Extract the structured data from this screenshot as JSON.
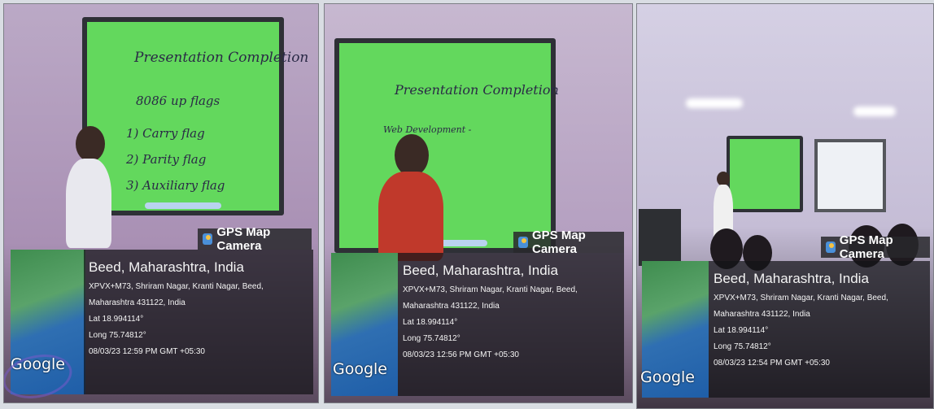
{
  "panels": [
    {
      "board_lines": [
        "Presentation Completion",
        "8086 up flags",
        "1) Carry flag",
        "2) Parity flag",
        "3) Auxiliary flag"
      ],
      "gps_tag": "GPS Map Camera",
      "title": "Beed, Maharashtra, India",
      "address1": "XPVX+M73, Shriram Nagar, Kranti Nagar, Beed,",
      "address2": "Maharashtra 431122, India",
      "lat": "Lat 18.994114°",
      "long": "Long 75.74812°",
      "datetime": "08/03/23 12:59 PM GMT +05:30",
      "map_label": "Google"
    },
    {
      "board_lines": [
        "Presentation Completion",
        "Web Development -"
      ],
      "gps_tag": "GPS Map Camera",
      "title": "Beed, Maharashtra, India",
      "address1": "XPVX+M73, Shriram Nagar, Kranti Nagar, Beed,",
      "address2": "Maharashtra 431122, India",
      "lat": "Lat 18.994114°",
      "long": "Long 75.74812°",
      "datetime": "08/03/23 12:56 PM GMT +05:30",
      "map_label": "Google"
    },
    {
      "gps_tag": "GPS Map Camera",
      "title": "Beed, Maharashtra, India",
      "address1": "XPVX+M73, Shriram Nagar, Kranti Nagar, Beed,",
      "address2": "Maharashtra 431122, India",
      "lat": "Lat 18.994114°",
      "long": "Long 75.74812°",
      "datetime": "08/03/23 12:54 PM GMT +05:30",
      "map_label": "Google"
    }
  ],
  "colors": {
    "board": "#63d85d",
    "overlay": "#141418",
    "map_water": "#1f5ea8"
  }
}
